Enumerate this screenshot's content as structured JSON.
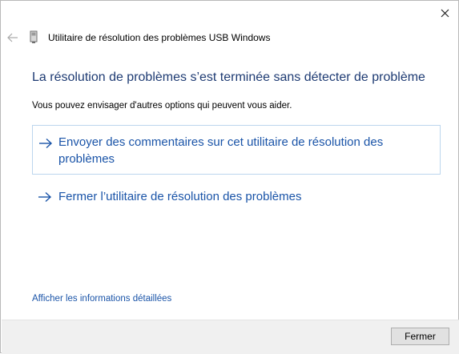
{
  "window": {
    "title": "Utilitaire de résolution des problèmes USB Windows",
    "close_icon": "close-icon",
    "back_icon": "back-arrow-icon",
    "app_icon": "usb-device-icon"
  },
  "main": {
    "heading": "La résolution de problèmes s’est terminée sans détecter de problème",
    "subtext": "Vous pouvez envisager d'autres options qui peuvent vous aider.",
    "options": [
      {
        "label": "Envoyer des commentaires sur cet utilitaire de résolution des problèmes",
        "icon": "arrow-right-icon"
      },
      {
        "label": "Fermer l’utilitaire de résolution des problèmes",
        "icon": "arrow-right-icon"
      }
    ],
    "details_link": "Afficher les informations détaillées"
  },
  "footer": {
    "close_button": "Fermer"
  },
  "colors": {
    "heading": "#1e3b73",
    "link": "#1a54a8",
    "footer_bg": "#f0f0f0"
  }
}
